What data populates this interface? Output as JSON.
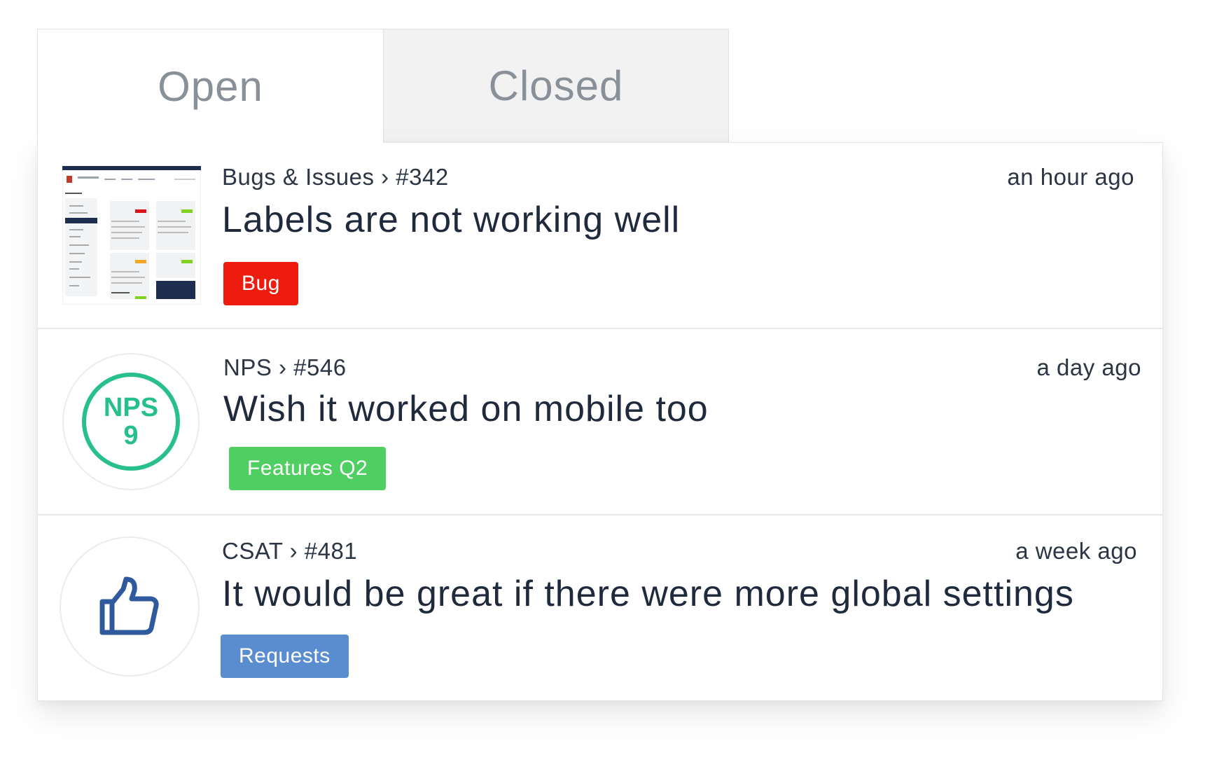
{
  "tabs": [
    {
      "label": "Open",
      "active": true
    },
    {
      "label": "Closed",
      "active": false
    }
  ],
  "items": [
    {
      "crumb": "Bugs & Issues › #342",
      "time": "an hour ago",
      "title": "Labels are not working well",
      "tag": {
        "label": "Bug",
        "color": "#ee1c0f"
      },
      "icon": "screenshot-thumbnail"
    },
    {
      "crumb": "NPS › #546",
      "time": "a day ago",
      "title": "Wish it worked on mobile too",
      "tag": {
        "label": "Features Q2",
        "color": "#4fce61"
      },
      "icon": "nps-badge",
      "nps": {
        "label": "NPS",
        "score": "9",
        "color": "#27c08a"
      }
    },
    {
      "crumb": "CSAT › #481",
      "time": "a week ago",
      "title": "It would be great if there were more global settings",
      "tag": {
        "label": "Requests",
        "color": "#5a8dcf"
      },
      "icon": "thumbs-up-icon",
      "icon_color": "#2f5a9e"
    }
  ]
}
